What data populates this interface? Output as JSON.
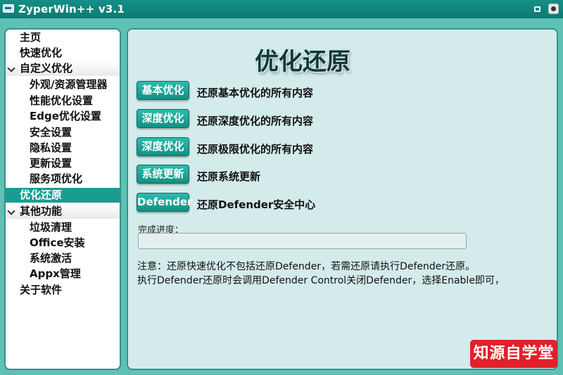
{
  "window": {
    "title": "ZyperWin++ v3.1"
  },
  "sidebar": {
    "items": [
      {
        "label": "主页"
      },
      {
        "label": "快速优化"
      },
      {
        "label": "自定义优化"
      },
      {
        "label": "外观/资源管理器"
      },
      {
        "label": "性能优化设置"
      },
      {
        "label": "Edge优化设置"
      },
      {
        "label": "安全设置"
      },
      {
        "label": "隐私设置"
      },
      {
        "label": "更新设置"
      },
      {
        "label": "服务项优化"
      },
      {
        "label": "优化还原"
      },
      {
        "label": "其他功能"
      },
      {
        "label": "垃圾清理"
      },
      {
        "label": "Office安装"
      },
      {
        "label": "系统激活"
      },
      {
        "label": "Appx管理"
      },
      {
        "label": "关于软件"
      }
    ]
  },
  "main": {
    "title": "优化还原",
    "actions": [
      {
        "button": "基本优化",
        "desc": "还原基本优化的所有内容"
      },
      {
        "button": "深度优化",
        "desc": "还原深度优化的所有内容"
      },
      {
        "button": "深度优化",
        "desc": "还原极限优化的所有内容"
      },
      {
        "button": "系统更新",
        "desc": "还原系统更新"
      },
      {
        "button": "Defender",
        "desc": "还原Defender安全中心"
      }
    ],
    "progress": {
      "label": "完成进度：",
      "value": 0
    },
    "notes": [
      "注意：还原快速优化不包括还原Defender，若需还原请执行Defender还原。",
      "执行Defender还原时会调用Defender Control关闭Defender，选择Enable即可，"
    ]
  },
  "watermark": {
    "text": "知源自学堂"
  },
  "colors": {
    "accent": "#199d92",
    "frame": "#5ec1b6",
    "panel": "#d3ebea",
    "watermark": "#e3202a"
  }
}
